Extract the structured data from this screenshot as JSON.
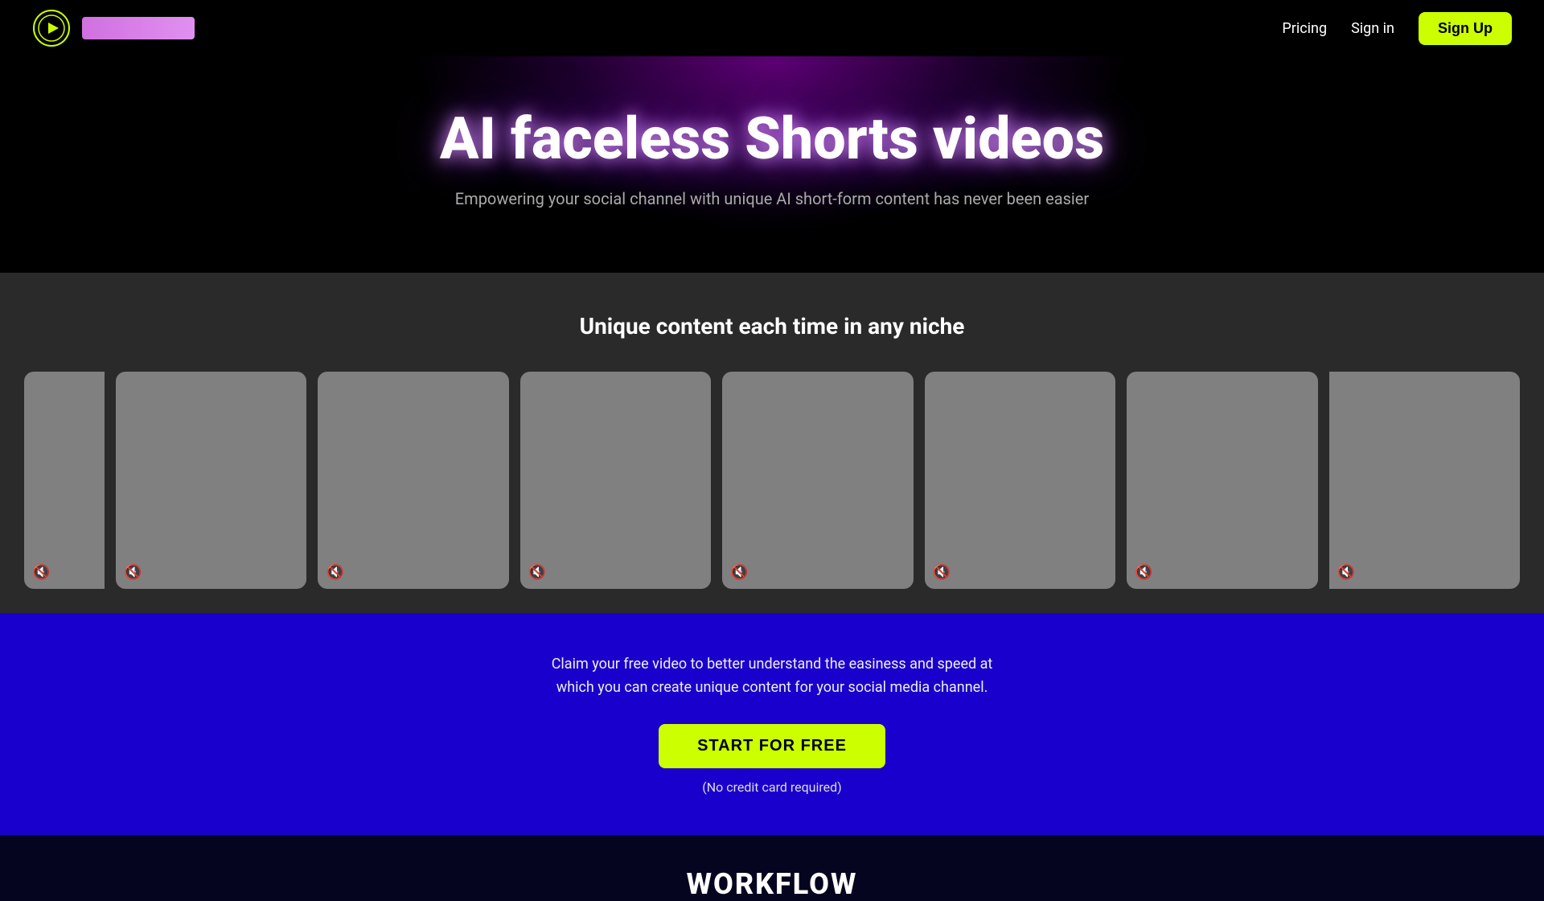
{
  "navbar": {
    "logo_alt": "AI Video App Logo",
    "logo_text_placeholder": "",
    "pricing_label": "Pricing",
    "signin_label": "Sign in",
    "signup_label": "Sign Up"
  },
  "hero": {
    "title": "AI faceless Shorts videos",
    "subtitle": "Empowering your social channel with unique AI short-form content has never been easier"
  },
  "video_section": {
    "section_title": "Unique content each time in any niche",
    "cards": [
      {
        "id": 1,
        "muted": true
      },
      {
        "id": 2,
        "muted": true
      },
      {
        "id": 3,
        "muted": true
      },
      {
        "id": 4,
        "muted": true
      },
      {
        "id": 5,
        "muted": true
      },
      {
        "id": 6,
        "muted": true
      },
      {
        "id": 7,
        "muted": true
      },
      {
        "id": 8,
        "muted": true
      }
    ]
  },
  "cta": {
    "description_line1": "Claim your free video to better understand the easiness and speed at",
    "description_line2": "which you can create unique content for your social media channel.",
    "button_label": "START FOR FREE",
    "note": "(No credit card required)"
  },
  "workflow": {
    "title": "WORKFLOW"
  },
  "icons": {
    "mute": "🔇",
    "logo": "💡"
  }
}
